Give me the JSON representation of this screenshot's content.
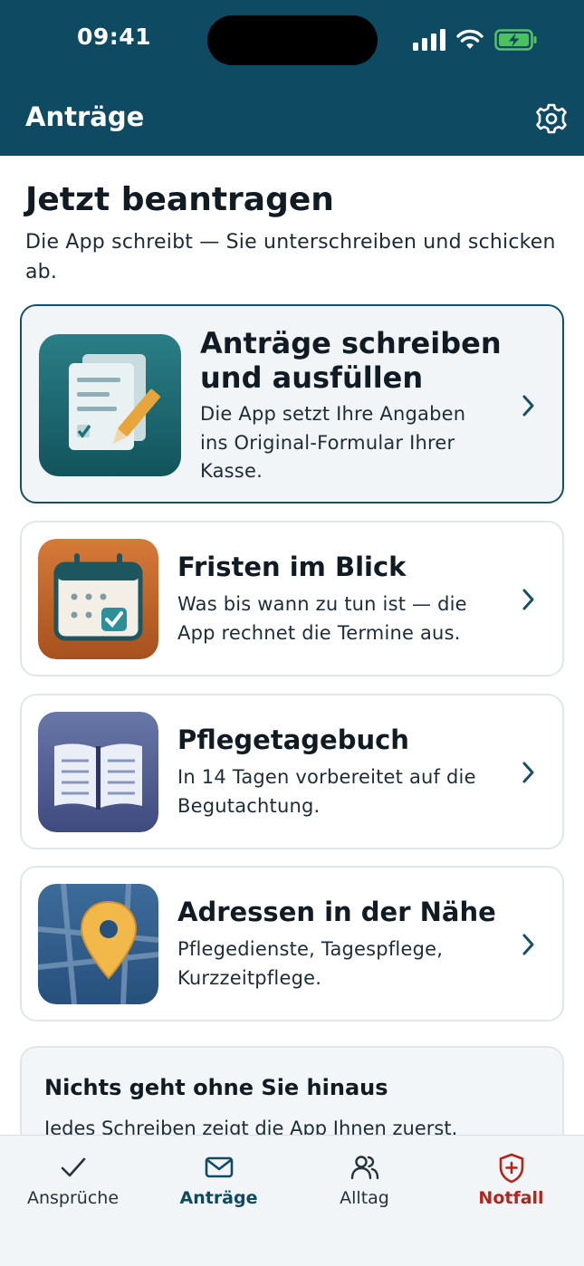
{
  "status_bar": {
    "time": "09:41"
  },
  "header": {
    "title": "Anträge"
  },
  "intro": {
    "title": "Jetzt beantragen",
    "subtitle": "Die App schreibt — Sie unterschreiben und schicken ab."
  },
  "cards": [
    {
      "title_line1": "Anträge schreiben",
      "title_line2": "und ausfüllen",
      "desc_line1": "Die App setzt Ihre Angaben",
      "desc_line2": "ins Original-Formular Ihrer",
      "desc_line3": "Kasse."
    },
    {
      "title": "Fristen im Blick",
      "desc_line1": "Was bis wann zu tun ist — die",
      "desc_line2": "App rechnet die Termine aus."
    },
    {
      "title": "Pflegetagebuch",
      "desc_line1": "In 14 Tagen vorbereitet auf die",
      "desc_line2": "Begutachtung."
    },
    {
      "title": "Adressen in der Nähe",
      "desc_line1": "Pflegedienste, Tagespflege,",
      "desc_line2": "Kurzzeitpflege."
    }
  ],
  "info": {
    "title": "Nichts geht ohne Sie hinaus",
    "text": "Jedes Schreiben zeigt die App Ihnen zuerst."
  },
  "tabs": [
    {
      "label": "Ansprüche",
      "icon": "checkmark-icon"
    },
    {
      "label": "Anträge",
      "icon": "envelope-icon"
    },
    {
      "label": "Alltag",
      "icon": "people-icon"
    },
    {
      "label": "Notfall",
      "icon": "shield-plus-icon"
    }
  ],
  "colors": {
    "header_bg": "#0f4a63",
    "accent": "#0f4a63",
    "emergency": "#b0261d"
  }
}
